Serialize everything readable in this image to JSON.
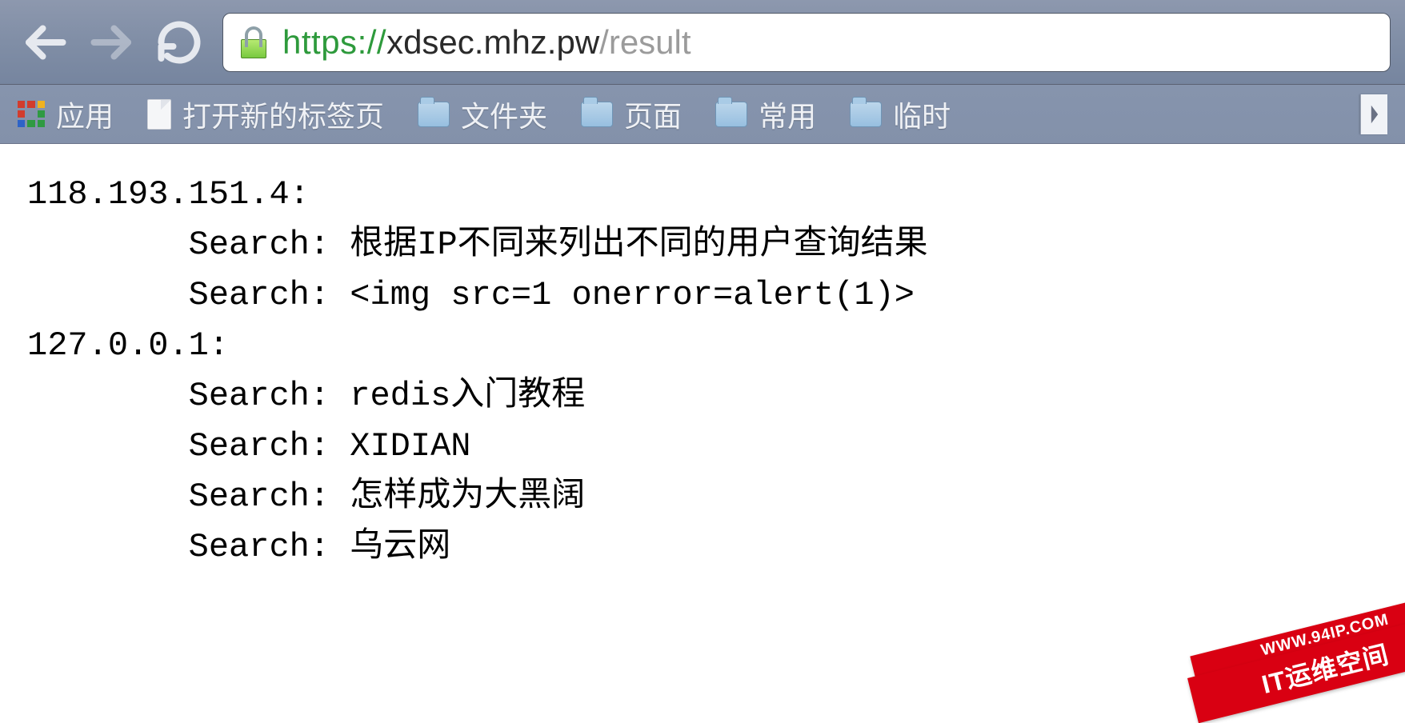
{
  "address": {
    "scheme": "https",
    "host": "xdsec.mhz.pw",
    "path": "/result"
  },
  "bookmarks": {
    "apps_label": "应用",
    "new_tab_label": "打开新的标签页",
    "folders": [
      "文件夹",
      "页面",
      "常用",
      "临时"
    ]
  },
  "page": {
    "groups": [
      {
        "ip": "118.193.151.4:",
        "lines": [
          "Search: 根据IP不同来列出不同的用户查询结果",
          "Search: <img src=1 onerror=alert(1)>"
        ]
      },
      {
        "ip": "127.0.0.1:",
        "lines": [
          "Search: redis入门教程",
          "Search: XIDIAN",
          "Search: 怎样成为大黑阔",
          "Search: 乌云网"
        ]
      }
    ]
  },
  "watermark": {
    "line1": "WWW.94IP.COM",
    "line2": "IT运维空间"
  }
}
